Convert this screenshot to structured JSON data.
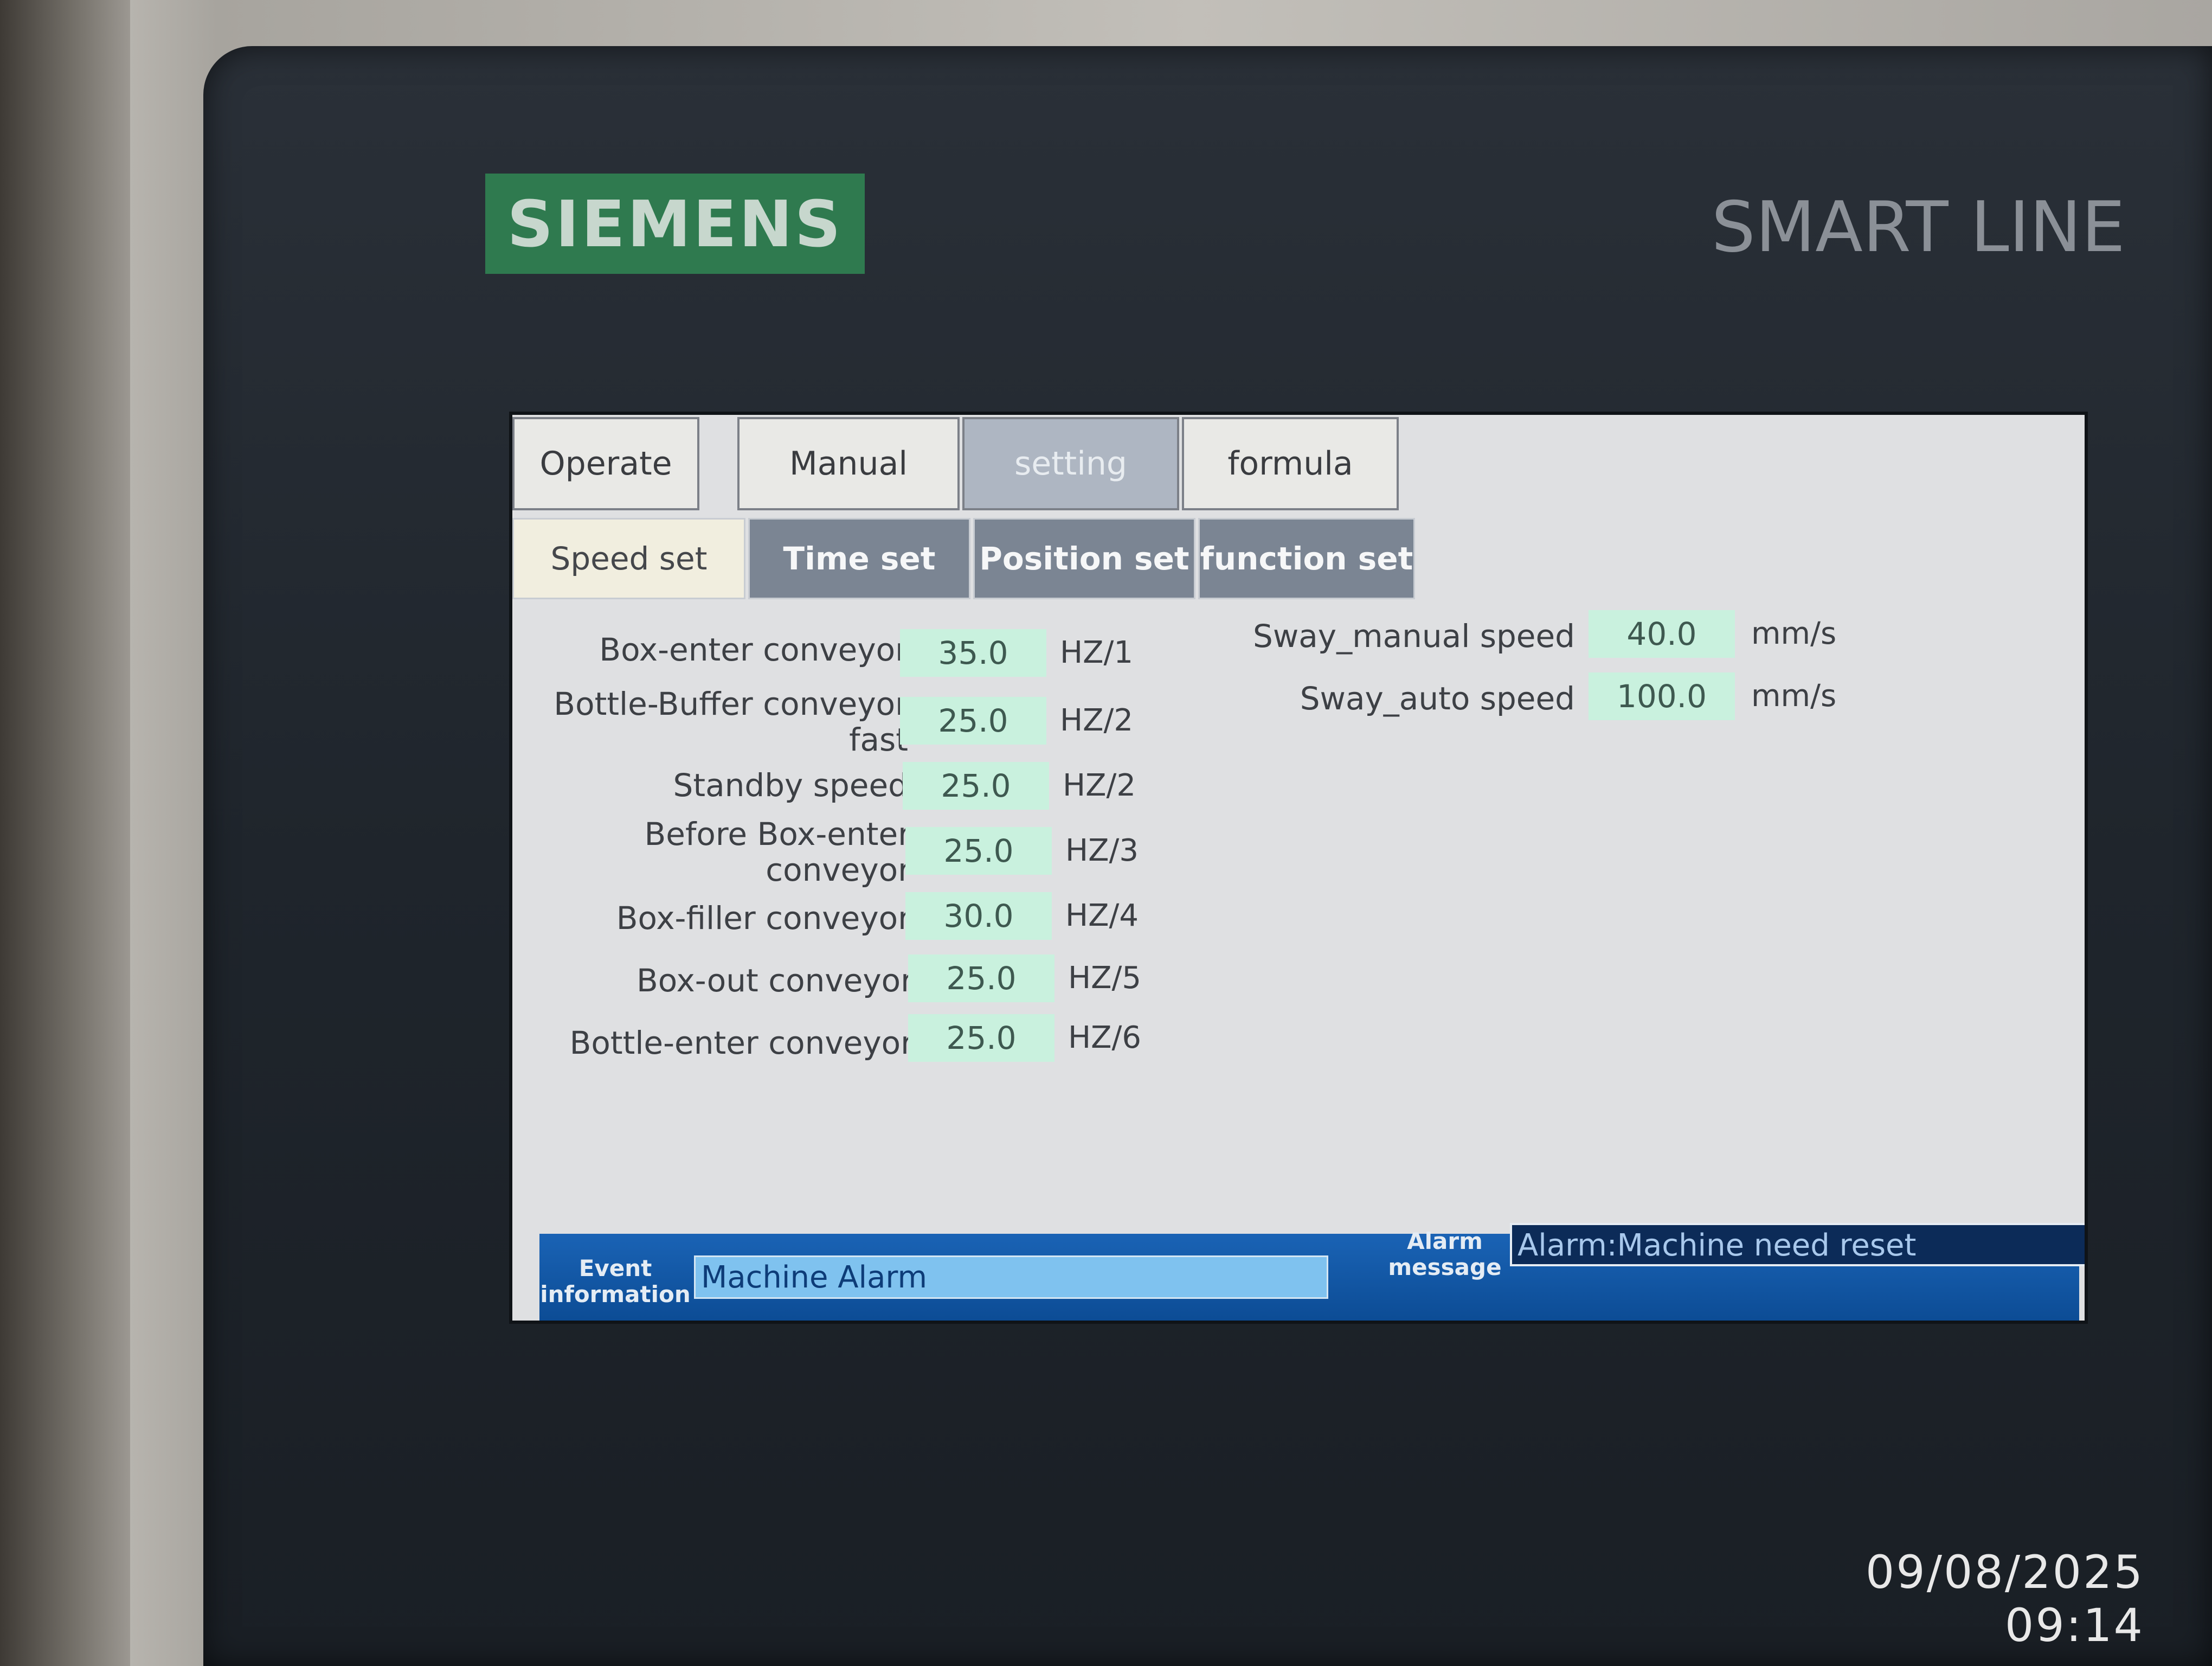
{
  "hardware": {
    "brand": "SIEMENS",
    "product_line": "SMART LINE",
    "brand_color": "#2f7a4f"
  },
  "main_tabs": [
    {
      "label": "Operate",
      "active": false
    },
    {
      "label": "Manual",
      "active": false
    },
    {
      "label": "setting",
      "active": true
    },
    {
      "label": "formula",
      "active": false
    }
  ],
  "sub_tabs": [
    {
      "label": "Speed set",
      "active": true
    },
    {
      "label": "Time set",
      "active": false
    },
    {
      "label": "Position set",
      "active": false
    },
    {
      "label": "function  set",
      "active": false
    }
  ],
  "speed_rows": [
    {
      "label": "Box-enter conveyor",
      "value": "35.0",
      "unit": "HZ/1"
    },
    {
      "label": "Bottle-Buffer conveyor fast",
      "value": "25.0",
      "unit": "HZ/2"
    },
    {
      "label": "Standby speed",
      "value": "25.0",
      "unit": "HZ/2"
    },
    {
      "label": "Before Box-enter conveyor",
      "value": "25.0",
      "unit": "HZ/3"
    },
    {
      "label": "Box-filler conveyor",
      "value": "30.0",
      "unit": "HZ/4"
    },
    {
      "label": "Box-out conveyor",
      "value": "25.0",
      "unit": "HZ/5"
    },
    {
      "label": "Bottle-enter conveyor",
      "value": "25.0",
      "unit": "HZ/6"
    }
  ],
  "sway_rows": [
    {
      "label": "Sway_manual speed",
      "value": "40.0",
      "unit": "mm/s"
    },
    {
      "label": "Sway_auto speed",
      "value": "100.0",
      "unit": "mm/s"
    }
  ],
  "status_bar": {
    "event_label": "Event information",
    "event_value": "Machine Alarm",
    "alarm_label": "Alarm message",
    "alarm_value": "Alarm:Machine need reset"
  },
  "photo_timestamp": "09/08/2025 09:14",
  "colors": {
    "input_field": "#c9f1de",
    "active_tab": "#aeb6c2",
    "status_bar": "#1a63b5"
  }
}
